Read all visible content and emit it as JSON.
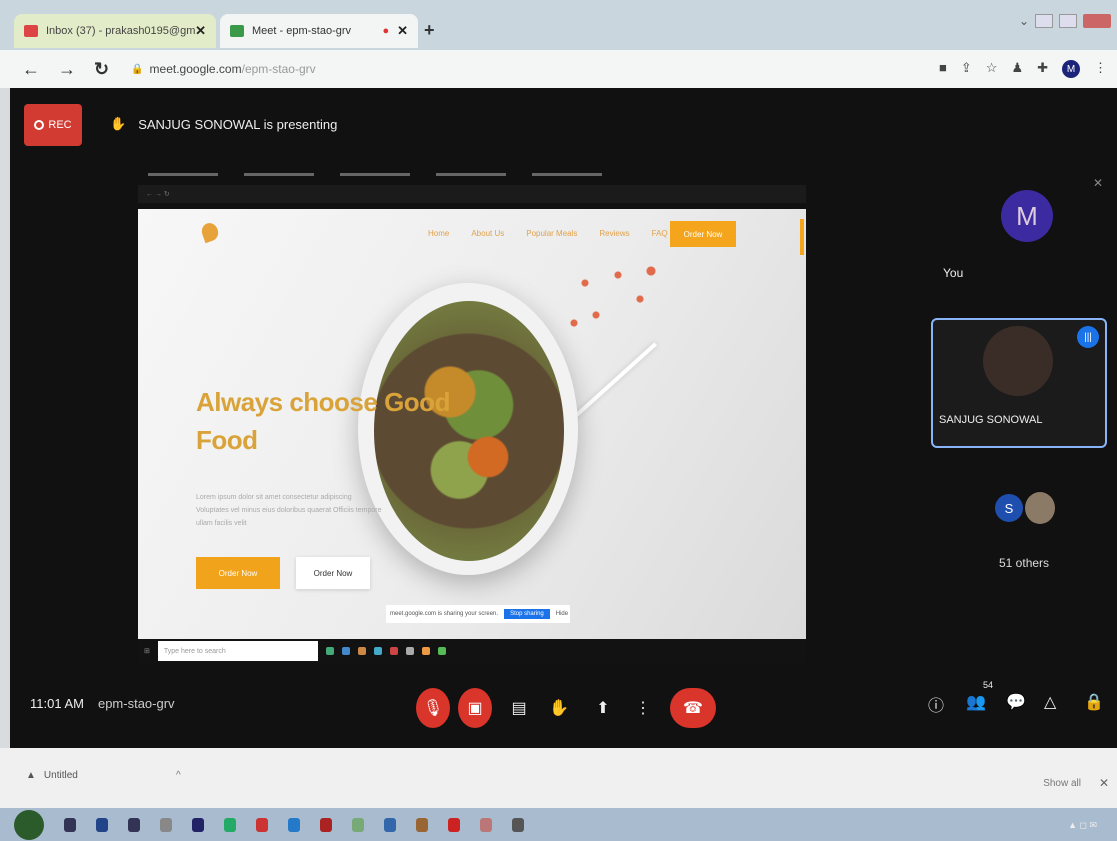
{
  "browser": {
    "tabs": [
      {
        "label": "Inbox (37) - prakash0195@gmai",
        "icon": "gmail-icon"
      },
      {
        "label": "Meet - epm-stao-grv",
        "icon": "meet-icon"
      }
    ],
    "url_domain": "meet.google.com",
    "url_path": "/epm-stao-grv",
    "profile_initial": "M"
  },
  "meet": {
    "rec_label": "REC",
    "presenting_text": "SANJUG SONOWAL is presenting",
    "shared_site": {
      "menu": [
        "Home",
        "About Us",
        "Popular Meals",
        "Reviews",
        "FAQ"
      ],
      "cta_top": "Order Now",
      "headline_line1": "Always choose Good",
      "headline_line2": "Food",
      "body": "Lorem ipsum dolor sit amet consectetur adipiscing Voluptates vel minus eius doloribus quaerat Officiis tempore ullam facilis velit",
      "btn_primary": "Order Now",
      "btn_secondary": "Order Now",
      "share_notice": "meet.google.com is sharing your screen.",
      "share_stop": "Stop sharing",
      "share_hide": "Hide",
      "taskbar_search": "Type here to search"
    },
    "participants": {
      "you_initial": "M",
      "you_label": "You",
      "presenter_name": "SANJUG SONOWAL",
      "others_initial": "S",
      "others_label": "51 others"
    },
    "bottom": {
      "time": "11:01 AM",
      "meeting_code": "epm-stao-grv",
      "people_count": "54"
    }
  },
  "downloads": {
    "file": "Untitled",
    "show_all": "Show all"
  }
}
